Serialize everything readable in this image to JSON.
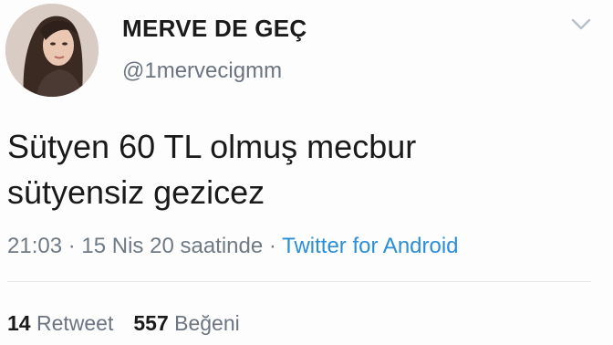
{
  "tweet": {
    "display_name": "MERVE DE GEÇ",
    "handle": "@1mervecigmm",
    "text_lines": [
      "Sütyen 60 TL olmuş mecbur",
      "sütyensiz gezicez"
    ],
    "time": "21:03",
    "date": "15 Nis 20 saatinde",
    "separator": "·",
    "source": "Twitter for Android",
    "retweet_count": "14",
    "retweet_label": "Retweet",
    "like_count": "557",
    "like_label": "Beğeni",
    "avatar_icon": "profile-photo",
    "menu_icon": "chevron-down-icon"
  },
  "colors": {
    "link": "#2a8fd8",
    "secondary_text": "#6b7480"
  }
}
